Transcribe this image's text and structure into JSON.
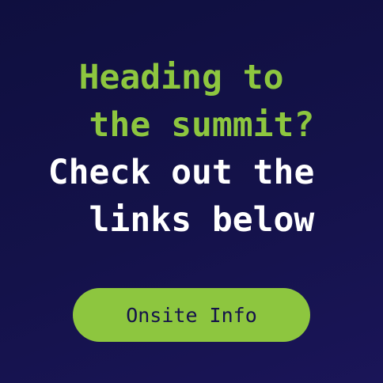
{
  "headline": {
    "line1": "Heading to ",
    "line2": " the summit?",
    "line3": "Check out the ",
    "line4": " links below"
  },
  "cta": {
    "label": "Onsite Info"
  },
  "colors": {
    "background": "#14124a",
    "accent": "#8dc63f",
    "text_light": "#ffffff"
  }
}
